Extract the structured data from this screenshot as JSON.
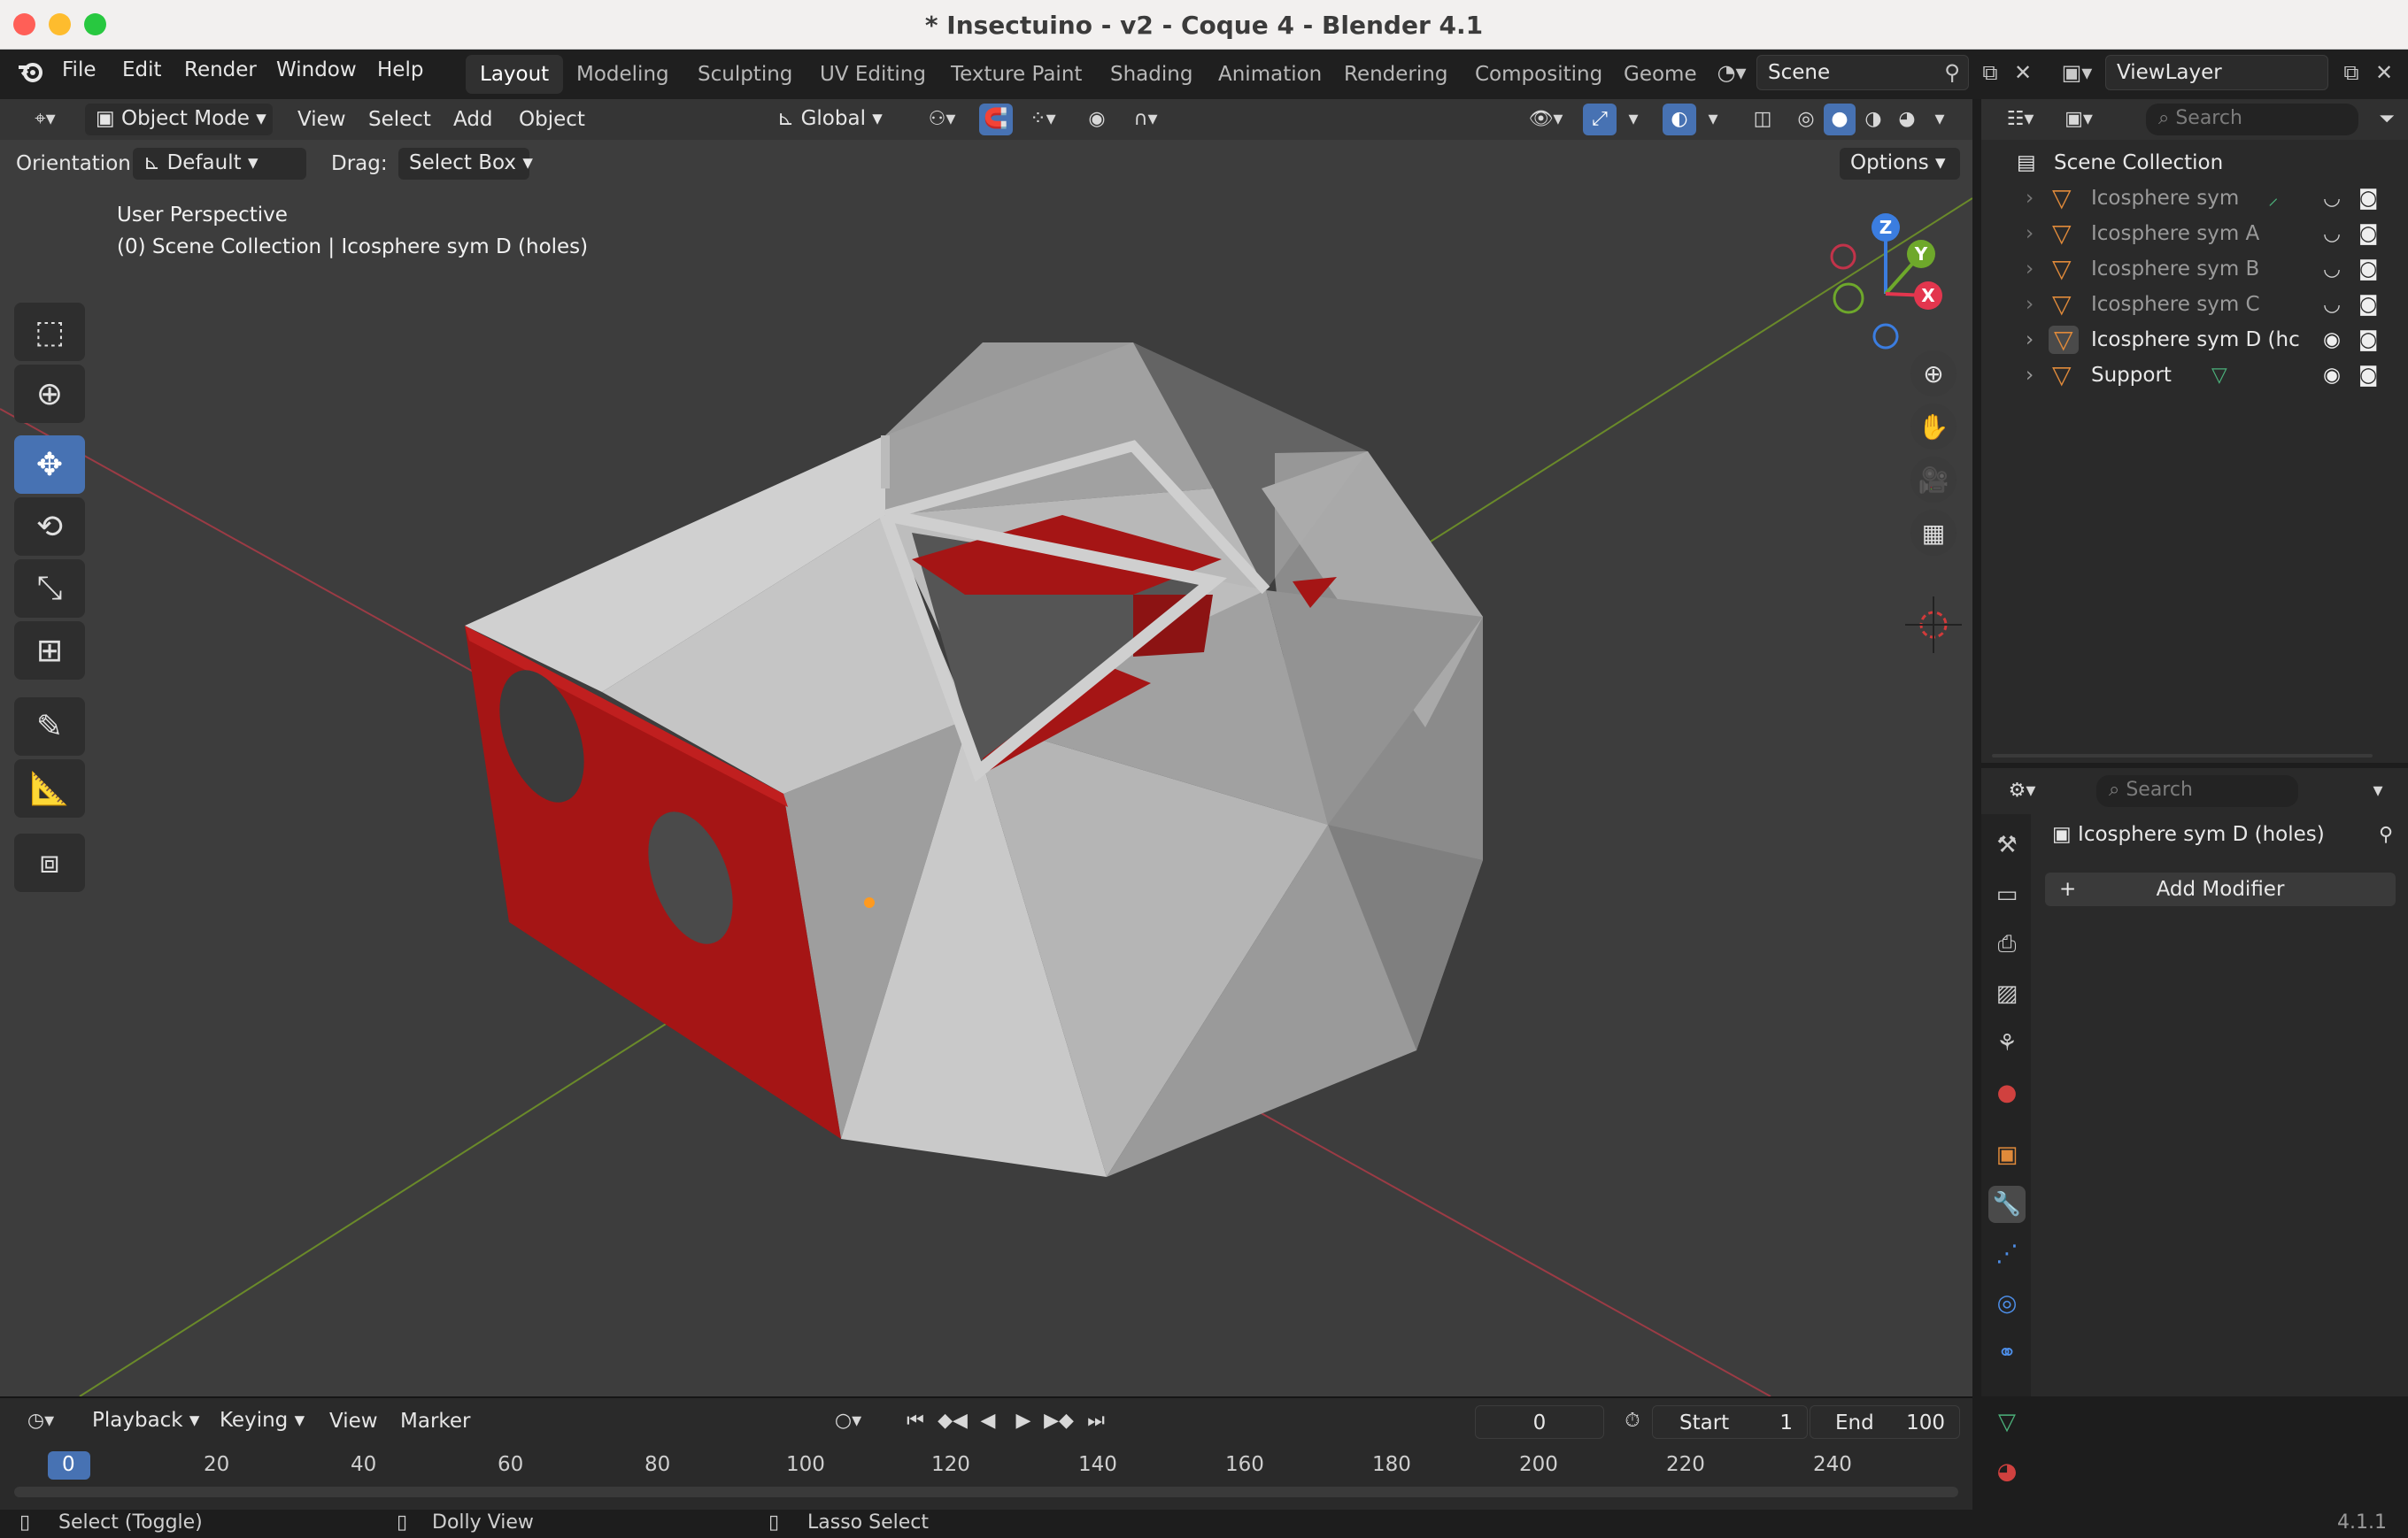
{
  "window": {
    "title": "* Insectuino - v2 - Coque 4 - Blender 4.1"
  },
  "menu": {
    "items": [
      "File",
      "Edit",
      "Render",
      "Window",
      "Help"
    ]
  },
  "workspaces": {
    "tabs": [
      "Layout",
      "Modeling",
      "Sculpting",
      "UV Editing",
      "Texture Paint",
      "Shading",
      "Animation",
      "Rendering",
      "Compositing",
      "Geome"
    ],
    "active": "Layout"
  },
  "scene": {
    "name": "Scene"
  },
  "view_layer": {
    "name": "ViewLayer"
  },
  "viewport_header": {
    "mode": "Object Mode",
    "menus": [
      "View",
      "Select",
      "Add",
      "Object"
    ],
    "transform_orientation": "Global"
  },
  "tool_settings": {
    "orientation_label": "Orientation:",
    "orientation_value": "Default",
    "drag_label": "Drag:",
    "drag_value": "Select Box",
    "options_label": "Options"
  },
  "viewport": {
    "perspective": "User Perspective",
    "context": "(0) Scene Collection | Icosphere sym D (holes)",
    "gizmo_axes": [
      "Z",
      "Y",
      "X"
    ]
  },
  "outliner": {
    "search_placeholder": "Search",
    "root": "Scene Collection",
    "items": [
      {
        "name": "Icosphere sym",
        "visible": false
      },
      {
        "name": "Icosphere sym A",
        "visible": false
      },
      {
        "name": "Icosphere sym B",
        "visible": false
      },
      {
        "name": "Icosphere sym C",
        "visible": false
      },
      {
        "name": "Icosphere sym D (hc",
        "visible": true
      },
      {
        "name": "Support",
        "visible": true
      }
    ]
  },
  "properties": {
    "search_placeholder": "Search",
    "object_name": "Icosphere sym D (holes)",
    "add_modifier": "Add Modifier"
  },
  "timeline": {
    "menus": [
      "Playback",
      "Keying",
      "View",
      "Marker"
    ],
    "current_frame": "0",
    "start_label": "Start",
    "start_value": "1",
    "end_label": "End",
    "end_value": "100",
    "ticks": [
      "0",
      "20",
      "40",
      "60",
      "80",
      "100",
      "120",
      "140",
      "160",
      "180",
      "200",
      "220",
      "240"
    ]
  },
  "statusbar": {
    "items": [
      "Select (Toggle)",
      "Dolly View",
      "Lasso Select"
    ],
    "version": "4.1.1"
  },
  "colors": {
    "active_tool": "#4772b3",
    "mesh_red": "#a51515",
    "mesh_grey": "#c3c3c3",
    "x_axis": "#e3364e",
    "y_axis": "#6ea82b",
    "z_axis": "#3b7de0"
  }
}
